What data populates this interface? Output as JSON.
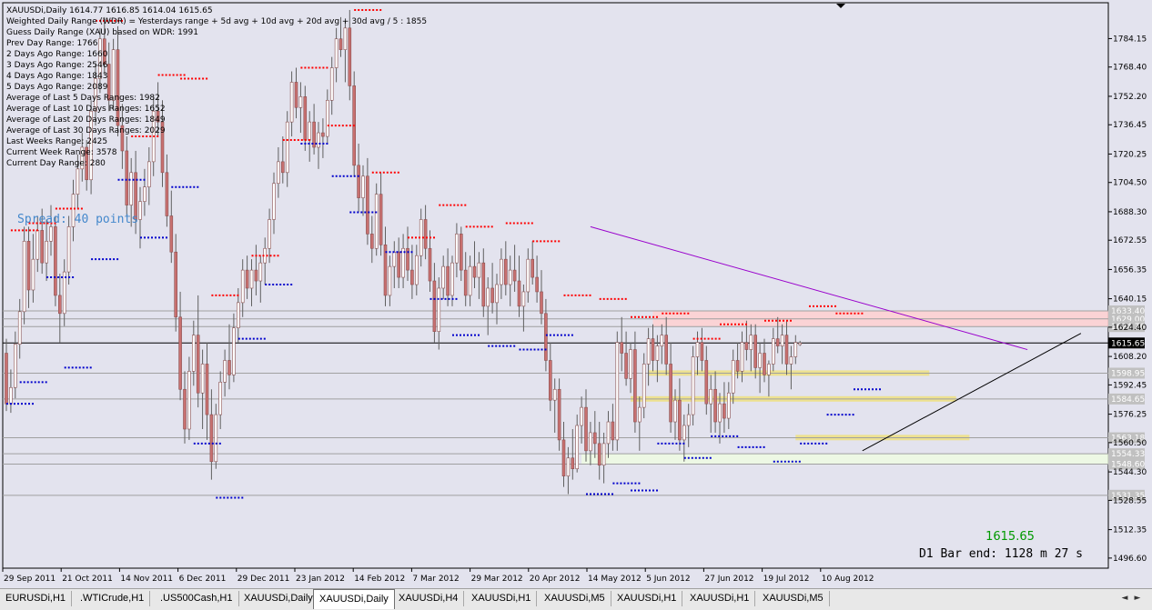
{
  "info_lines": [
    "XAUUSDi,Daily  1614.77 1616.85 1614.04 1615.65",
    "Weighted Daily Range (WDR) = Yesterdays range + 5d avg + 10d avg + 20d avg + 30d avg / 5 : 1855",
    "Guess Daily Range (XAU) based on WDR: 1991",
    "Prev Day Range: 1766",
    "2 Days Ago Range: 1660",
    "3 Days Ago Range: 2546",
    "4 Days Ago Range: 1843",
    "5 Days Ago Range: 2089",
    "Average of Last 5 Days Ranges: 1982",
    "Average of Last 10 Days Ranges: 1652",
    "Average of Last 20 Days Ranges: 1849",
    "Average of Last 30 Days Ranges: 2029",
    "Last Weeks Range: 2425",
    "Current Week Range: 3578",
    "Current Day Range: 280"
  ],
  "spread_text": "Spread: 40 points",
  "price_big": "1615.65",
  "bar_end_text": "D1 Bar end: 1128 m 27 s",
  "tabs": [
    "EURUSDi,H1",
    ".WTICrude,H1",
    ".US500Cash,H1",
    "XAUUSDi,Daily",
    "XAUUSDi,Daily",
    "XAUUSDi,H4",
    "XAUUSDi,H1",
    "XAUUSDi,M5",
    "XAUUSDi,H1",
    "XAUUSDi,H1",
    "XAUUSDi,M5"
  ],
  "active_tab": 4,
  "nav": {
    "left": "◄",
    "right": "►"
  },
  "colors": {
    "bull": "#ffffff",
    "bear": "#c87070",
    "wick": "#606060",
    "res_dots": "#ff0000",
    "sup_dots": "#0000cc",
    "trend_res": "#9900cc",
    "trend_sup": "#000000",
    "zone_pink": "#ffd0d0",
    "zone_yellow": "#f0e070",
    "zone_lightgreen": "#f0ffe0",
    "current_line": "#000000",
    "label_gray": "#c0c0c0",
    "label_black": "#000000",
    "price_green": "#009900",
    "spread_blue": "#4488cc"
  },
  "chart_data": {
    "type": "candlestick",
    "symbol": "XAUUSDi",
    "timeframe": "Daily",
    "x_labels": [
      "29 Sep 2011",
      "21 Oct 2011",
      "14 Nov 2011",
      "6 Dec 2011",
      "29 Dec 2011",
      "23 Jan 2012",
      "14 Feb 2012",
      "7 Mar 2012",
      "29 Mar 2012",
      "20 Apr 2012",
      "14 May 2012",
      "5 Jun 2012",
      "27 Jun 2012",
      "19 Jul 2012",
      "10 Aug 2012"
    ],
    "y_ticks": [
      1784.15,
      1768.4,
      1752.2,
      1736.45,
      1720.25,
      1704.5,
      1688.3,
      1672.55,
      1656.35,
      1640.15,
      1624.4,
      1608.2,
      1592.45,
      1576.25,
      1560.5,
      1544.3,
      1528.55,
      1512.35,
      1496.6
    ],
    "ylim": [
      1491,
      1804
    ],
    "last": {
      "open": 1614.77,
      "high": 1616.85,
      "low": 1614.04,
      "close": 1615.65
    },
    "horizontal_levels": [
      {
        "price": 1633.4,
        "label": "1633.40",
        "style": "gray"
      },
      {
        "price": 1629.0,
        "label": "1629.00",
        "style": "gray"
      },
      {
        "price": 1624.76,
        "label": "1624.76",
        "style": "gray"
      },
      {
        "price": 1615.65,
        "label": "1615.65",
        "style": "current"
      },
      {
        "price": 1598.95,
        "label": "1598.95",
        "style": "gray"
      },
      {
        "price": 1584.65,
        "label": "1584.65",
        "style": "gray"
      },
      {
        "price": 1563.18,
        "label": "1563.18",
        "style": "gray"
      },
      {
        "price": 1554.33,
        "label": "1554.33",
        "style": "gray"
      },
      {
        "price": 1548.6,
        "label": "1548.60",
        "style": "gray"
      },
      {
        "price": 1531.35,
        "label": "1531.35",
        "style": "gray"
      }
    ],
    "zones": [
      {
        "from_bar": 145,
        "to_bar": 999,
        "low": 1624.8,
        "high": 1633.4,
        "color": "pink"
      },
      {
        "from_bar": 144,
        "to_bar": 207,
        "low": 1597.5,
        "high": 1600.5,
        "color": "yellow"
      },
      {
        "from_bar": 140,
        "to_bar": 213,
        "low": 1583.2,
        "high": 1586.2,
        "color": "yellow"
      },
      {
        "from_bar": 177,
        "to_bar": 216,
        "low": 1561.8,
        "high": 1564.8,
        "color": "yellow"
      },
      {
        "from_bar": 129,
        "to_bar": 282,
        "low": 1548.3,
        "high": 1554.3,
        "color": "lightgreen"
      }
    ],
    "trendlines": [
      {
        "x1_bar": 131,
        "y1": 1680,
        "x2_bar": 229,
        "y2": 1612,
        "color": "purple"
      },
      {
        "x1_bar": 192,
        "y1": 1556,
        "x2_bar": 241,
        "y2": 1621,
        "color": "black"
      }
    ],
    "candles": [
      [
        1610,
        1618,
        1578,
        1582
      ],
      [
        1582,
        1601,
        1577,
        1591
      ],
      [
        1591,
        1622,
        1585,
        1615
      ],
      [
        1615,
        1640,
        1607,
        1633
      ],
      [
        1633,
        1680,
        1626,
        1672
      ],
      [
        1672,
        1680,
        1635,
        1645
      ],
      [
        1645,
        1676,
        1638,
        1662
      ],
      [
        1662,
        1686,
        1655,
        1678
      ],
      [
        1678,
        1690,
        1654,
        1660
      ],
      [
        1660,
        1684,
        1650,
        1672
      ],
      [
        1672,
        1692,
        1664,
        1680
      ],
      [
        1680,
        1686,
        1636,
        1642
      ],
      [
        1642,
        1654,
        1616,
        1632
      ],
      [
        1632,
        1662,
        1625,
        1655
      ],
      [
        1655,
        1686,
        1648,
        1680
      ],
      [
        1680,
        1706,
        1672,
        1698
      ],
      [
        1698,
        1720,
        1690,
        1712
      ],
      [
        1712,
        1732,
        1705,
        1724
      ],
      [
        1724,
        1728,
        1700,
        1706
      ],
      [
        1706,
        1750,
        1698,
        1744
      ],
      [
        1744,
        1770,
        1736,
        1762
      ],
      [
        1762,
        1790,
        1754,
        1784
      ],
      [
        1784,
        1796,
        1764,
        1770
      ],
      [
        1770,
        1782,
        1744,
        1750
      ],
      [
        1750,
        1784,
        1745,
        1778
      ],
      [
        1778,
        1791,
        1730,
        1736
      ],
      [
        1736,
        1748,
        1712,
        1722
      ],
      [
        1722,
        1730,
        1686,
        1692
      ],
      [
        1692,
        1718,
        1680,
        1710
      ],
      [
        1710,
        1722,
        1676,
        1684
      ],
      [
        1684,
        1702,
        1668,
        1694
      ],
      [
        1694,
        1712,
        1686,
        1702
      ],
      [
        1702,
        1724,
        1692,
        1716
      ],
      [
        1716,
        1752,
        1708,
        1744
      ],
      [
        1744,
        1760,
        1730,
        1738
      ],
      [
        1738,
        1750,
        1702,
        1710
      ],
      [
        1710,
        1720,
        1680,
        1686
      ],
      [
        1686,
        1700,
        1660,
        1666
      ],
      [
        1666,
        1676,
        1622,
        1630
      ],
      [
        1630,
        1644,
        1584,
        1590
      ],
      [
        1590,
        1600,
        1560,
        1568
      ],
      [
        1568,
        1608,
        1562,
        1600
      ],
      [
        1600,
        1628,
        1592,
        1620
      ],
      [
        1620,
        1642,
        1580,
        1588
      ],
      [
        1588,
        1612,
        1568,
        1604
      ],
      [
        1604,
        1616,
        1562,
        1576
      ],
      [
        1576,
        1590,
        1540,
        1550
      ],
      [
        1550,
        1582,
        1546,
        1576
      ],
      [
        1576,
        1600,
        1568,
        1594
      ],
      [
        1594,
        1612,
        1586,
        1606
      ],
      [
        1606,
        1626,
        1590,
        1598
      ],
      [
        1598,
        1632,
        1594,
        1624
      ],
      [
        1624,
        1646,
        1616,
        1638
      ],
      [
        1638,
        1662,
        1630,
        1656
      ],
      [
        1656,
        1664,
        1640,
        1646
      ],
      [
        1646,
        1662,
        1636,
        1656
      ],
      [
        1656,
        1670,
        1642,
        1650
      ],
      [
        1650,
        1664,
        1638,
        1660
      ],
      [
        1660,
        1674,
        1648,
        1668
      ],
      [
        1668,
        1690,
        1660,
        1684
      ],
      [
        1684,
        1710,
        1676,
        1704
      ],
      [
        1704,
        1724,
        1696,
        1716
      ],
      [
        1716,
        1730,
        1704,
        1710
      ],
      [
        1710,
        1744,
        1702,
        1738
      ],
      [
        1738,
        1766,
        1730,
        1760
      ],
      [
        1760,
        1768,
        1740,
        1746
      ],
      [
        1746,
        1760,
        1732,
        1752
      ],
      [
        1752,
        1758,
        1722,
        1728
      ],
      [
        1728,
        1744,
        1716,
        1738
      ],
      [
        1738,
        1748,
        1720,
        1724
      ],
      [
        1724,
        1738,
        1712,
        1732
      ],
      [
        1732,
        1740,
        1718,
        1730
      ],
      [
        1730,
        1756,
        1726,
        1750
      ],
      [
        1750,
        1774,
        1742,
        1768
      ],
      [
        1768,
        1790,
        1760,
        1784
      ],
      [
        1784,
        1796,
        1774,
        1778
      ],
      [
        1778,
        1794,
        1760,
        1790
      ],
      [
        1790,
        1800,
        1750,
        1758
      ],
      [
        1758,
        1766,
        1708,
        1714
      ],
      [
        1714,
        1726,
        1688,
        1696
      ],
      [
        1696,
        1714,
        1686,
        1708
      ],
      [
        1708,
        1718,
        1670,
        1676
      ],
      [
        1676,
        1686,
        1660,
        1668
      ],
      [
        1668,
        1704,
        1664,
        1698
      ],
      [
        1698,
        1710,
        1664,
        1670
      ],
      [
        1670,
        1680,
        1636,
        1642
      ],
      [
        1642,
        1664,
        1636,
        1658
      ],
      [
        1658,
        1672,
        1646,
        1666
      ],
      [
        1666,
        1674,
        1646,
        1652
      ],
      [
        1652,
        1676,
        1646,
        1668
      ],
      [
        1668,
        1680,
        1650,
        1656
      ],
      [
        1656,
        1670,
        1640,
        1648
      ],
      [
        1648,
        1670,
        1642,
        1664
      ],
      [
        1664,
        1690,
        1658,
        1684
      ],
      [
        1684,
        1692,
        1662,
        1668
      ],
      [
        1668,
        1678,
        1644,
        1650
      ],
      [
        1650,
        1660,
        1616,
        1622
      ],
      [
        1622,
        1652,
        1612,
        1646
      ],
      [
        1646,
        1664,
        1640,
        1658
      ],
      [
        1658,
        1668,
        1636,
        1642
      ],
      [
        1642,
        1664,
        1636,
        1660
      ],
      [
        1660,
        1682,
        1652,
        1676
      ],
      [
        1676,
        1680,
        1650,
        1656
      ],
      [
        1656,
        1666,
        1636,
        1642
      ],
      [
        1642,
        1664,
        1636,
        1658
      ],
      [
        1658,
        1672,
        1646,
        1652
      ],
      [
        1652,
        1666,
        1640,
        1660
      ],
      [
        1660,
        1668,
        1630,
        1636
      ],
      [
        1636,
        1652,
        1620,
        1646
      ],
      [
        1646,
        1660,
        1632,
        1638
      ],
      [
        1638,
        1654,
        1626,
        1648
      ],
      [
        1648,
        1668,
        1640,
        1662
      ],
      [
        1662,
        1672,
        1642,
        1648
      ],
      [
        1648,
        1664,
        1636,
        1656
      ],
      [
        1656,
        1670,
        1644,
        1650
      ],
      [
        1650,
        1664,
        1630,
        1636
      ],
      [
        1636,
        1648,
        1622,
        1644
      ],
      [
        1644,
        1668,
        1638,
        1662
      ],
      [
        1662,
        1672,
        1648,
        1652
      ],
      [
        1652,
        1664,
        1638,
        1644
      ],
      [
        1644,
        1656,
        1626,
        1632
      ],
      [
        1632,
        1640,
        1600,
        1606
      ],
      [
        1606,
        1616,
        1578,
        1584
      ],
      [
        1584,
        1596,
        1566,
        1590
      ],
      [
        1590,
        1596,
        1556,
        1562
      ],
      [
        1562,
        1572,
        1536,
        1542
      ],
      [
        1542,
        1558,
        1532,
        1552
      ],
      [
        1552,
        1568,
        1540,
        1546
      ],
      [
        1546,
        1576,
        1544,
        1570
      ],
      [
        1570,
        1586,
        1560,
        1580
      ],
      [
        1580,
        1590,
        1550,
        1556
      ],
      [
        1556,
        1572,
        1548,
        1566
      ],
      [
        1566,
        1578,
        1552,
        1560
      ],
      [
        1560,
        1572,
        1540,
        1548
      ],
      [
        1548,
        1566,
        1538,
        1560
      ],
      [
        1560,
        1578,
        1552,
        1572
      ],
      [
        1572,
        1582,
        1556,
        1562
      ],
      [
        1562,
        1622,
        1556,
        1616
      ],
      [
        1616,
        1630,
        1600,
        1610
      ],
      [
        1610,
        1622,
        1592,
        1596
      ],
      [
        1596,
        1616,
        1588,
        1612
      ],
      [
        1612,
        1622,
        1566,
        1572
      ],
      [
        1572,
        1586,
        1556,
        1580
      ],
      [
        1580,
        1610,
        1574,
        1604
      ],
      [
        1604,
        1624,
        1592,
        1618
      ],
      [
        1618,
        1626,
        1600,
        1606
      ],
      [
        1606,
        1620,
        1594,
        1614
      ],
      [
        1614,
        1626,
        1604,
        1620
      ],
      [
        1620,
        1630,
        1598,
        1604
      ],
      [
        1604,
        1616,
        1566,
        1572
      ],
      [
        1572,
        1590,
        1562,
        1584
      ],
      [
        1584,
        1596,
        1556,
        1562
      ],
      [
        1562,
        1576,
        1550,
        1570
      ],
      [
        1570,
        1582,
        1558,
        1576
      ],
      [
        1576,
        1614,
        1570,
        1608
      ],
      [
        1608,
        1622,
        1598,
        1616
      ],
      [
        1616,
        1624,
        1600,
        1606
      ],
      [
        1606,
        1614,
        1576,
        1582
      ],
      [
        1582,
        1598,
        1566,
        1590
      ],
      [
        1590,
        1600,
        1566,
        1572
      ],
      [
        1572,
        1588,
        1560,
        1582
      ],
      [
        1582,
        1594,
        1566,
        1574
      ],
      [
        1574,
        1594,
        1568,
        1588
      ],
      [
        1588,
        1612,
        1582,
        1606
      ],
      [
        1606,
        1616,
        1596,
        1600
      ],
      [
        1600,
        1622,
        1594,
        1616
      ],
      [
        1616,
        1628,
        1606,
        1612
      ],
      [
        1612,
        1626,
        1600,
        1620
      ],
      [
        1620,
        1626,
        1596,
        1602
      ],
      [
        1602,
        1616,
        1588,
        1610
      ],
      [
        1610,
        1618,
        1594,
        1598
      ],
      [
        1598,
        1606,
        1586,
        1604
      ],
      [
        1604,
        1624,
        1600,
        1618
      ],
      [
        1618,
        1630,
        1610,
        1614
      ],
      [
        1614,
        1626,
        1604,
        1620
      ],
      [
        1620,
        1628,
        1598,
        1604
      ],
      [
        1604,
        1614,
        1590,
        1608
      ],
      [
        1608,
        1620,
        1604,
        1616
      ],
      [
        1614.77,
        1616.85,
        1614.04,
        1615.65
      ]
    ],
    "res_marks": [
      [
        1,
        1678
      ],
      [
        5,
        1682
      ],
      [
        11,
        1690
      ],
      [
        20,
        1794
      ],
      [
        28,
        1730
      ],
      [
        34,
        1764
      ],
      [
        39,
        1762
      ],
      [
        46,
        1642
      ],
      [
        55,
        1664
      ],
      [
        62,
        1728
      ],
      [
        66,
        1768
      ],
      [
        72,
        1736
      ],
      [
        78,
        1800
      ],
      [
        82,
        1710
      ],
      [
        90,
        1674
      ],
      [
        97,
        1692
      ],
      [
        103,
        1680
      ],
      [
        112,
        1682
      ],
      [
        118,
        1672
      ],
      [
        125,
        1642
      ],
      [
        133,
        1640
      ],
      [
        140,
        1630
      ],
      [
        147,
        1632
      ],
      [
        154,
        1618
      ],
      [
        160,
        1626
      ],
      [
        170,
        1628
      ],
      [
        180,
        1636
      ],
      [
        186,
        1632
      ]
    ],
    "sup_marks": [
      [
        0,
        1582
      ],
      [
        3,
        1594
      ],
      [
        9,
        1652
      ],
      [
        13,
        1602
      ],
      [
        19,
        1662
      ],
      [
        25,
        1706
      ],
      [
        30,
        1674
      ],
      [
        37,
        1702
      ],
      [
        42,
        1560
      ],
      [
        47,
        1530
      ],
      [
        52,
        1618
      ],
      [
        58,
        1648
      ],
      [
        66,
        1726
      ],
      [
        73,
        1708
      ],
      [
        77,
        1688
      ],
      [
        85,
        1666
      ],
      [
        95,
        1640
      ],
      [
        100,
        1620
      ],
      [
        108,
        1614
      ],
      [
        115,
        1612
      ],
      [
        121,
        1620
      ],
      [
        130,
        1532
      ],
      [
        136,
        1538
      ],
      [
        140,
        1534
      ],
      [
        146,
        1560
      ],
      [
        152,
        1552
      ],
      [
        158,
        1564
      ],
      [
        164,
        1558
      ],
      [
        172,
        1550
      ],
      [
        178,
        1560
      ],
      [
        184,
        1576
      ],
      [
        190,
        1590
      ]
    ]
  }
}
